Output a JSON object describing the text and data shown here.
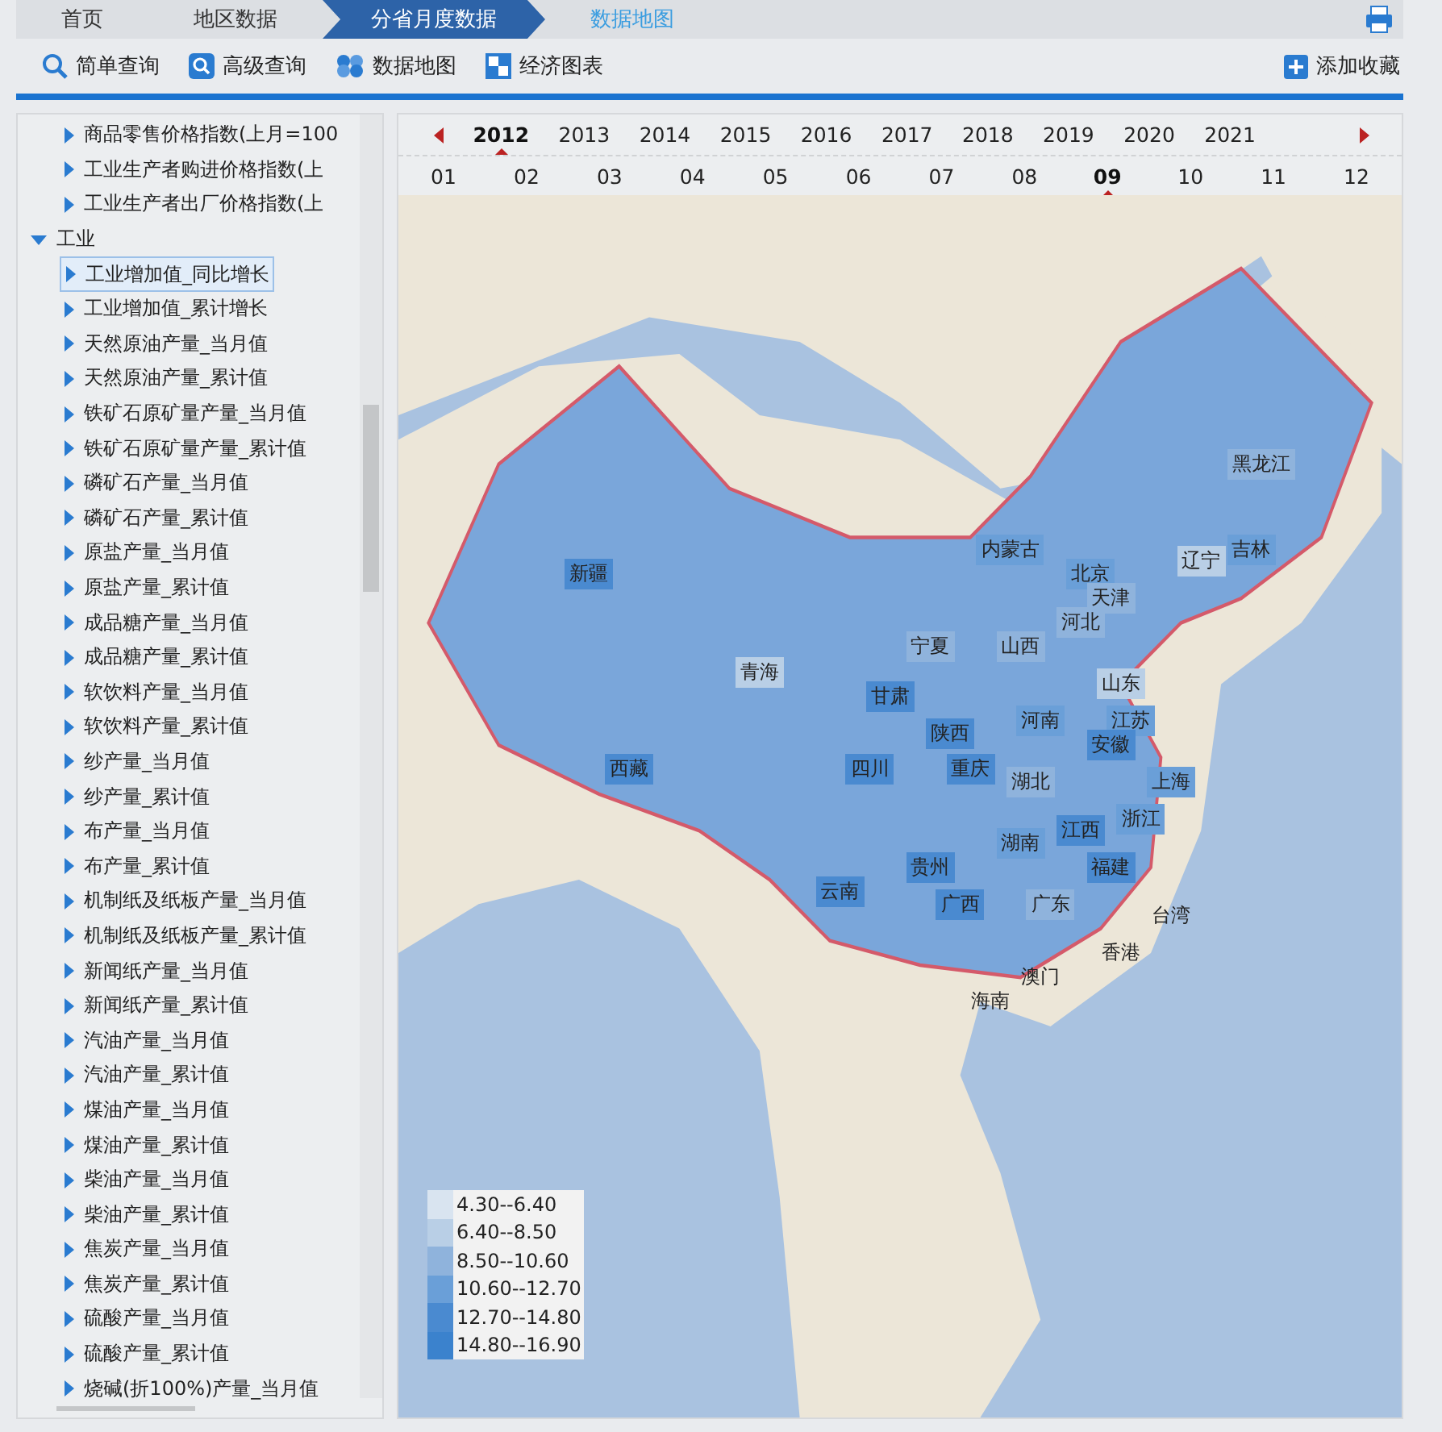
{
  "breadcrumb": [
    {
      "label": "首页",
      "selected": false
    },
    {
      "label": "地区数据",
      "selected": false
    },
    {
      "label": "分省月度数据",
      "selected": true
    },
    {
      "label": "数据地图",
      "selected": false
    }
  ],
  "toolbar": [
    {
      "label": "简单查询",
      "kind": "search"
    },
    {
      "label": "高级查询",
      "kind": "advanced"
    },
    {
      "label": "数据地图",
      "kind": "map"
    },
    {
      "label": "经济图表",
      "kind": "chart"
    }
  ],
  "add_favorite": "添加收藏",
  "tree": [
    {
      "children": [
        {
          "label": "商品零售价格指数(上月=100",
          "selected": false
        },
        {
          "label": "工业生产者购进价格指数(上",
          "selected": false
        },
        {
          "label": "工业生产者出厂价格指数(上",
          "selected": false
        }
      ]
    },
    {
      "label": "工业",
      "expanded": true,
      "children": [
        {
          "label": "工业增加值_同比增长",
          "selected": true
        },
        {
          "label": "工业增加值_累计增长",
          "selected": false
        },
        {
          "label": "天然原油产量_当月值",
          "selected": false
        },
        {
          "label": "天然原油产量_累计值",
          "selected": false
        },
        {
          "label": "铁矿石原矿量产量_当月值",
          "selected": false
        },
        {
          "label": "铁矿石原矿量产量_累计值",
          "selected": false
        },
        {
          "label": "磷矿石产量_当月值",
          "selected": false
        },
        {
          "label": "磷矿石产量_累计值",
          "selected": false
        },
        {
          "label": "原盐产量_当月值",
          "selected": false
        },
        {
          "label": "原盐产量_累计值",
          "selected": false
        },
        {
          "label": "成品糖产量_当月值",
          "selected": false
        },
        {
          "label": "成品糖产量_累计值",
          "selected": false
        },
        {
          "label": "软饮料产量_当月值",
          "selected": false
        },
        {
          "label": "软饮料产量_累计值",
          "selected": false
        },
        {
          "label": "纱产量_当月值",
          "selected": false
        },
        {
          "label": "纱产量_累计值",
          "selected": false
        },
        {
          "label": "布产量_当月值",
          "selected": false
        },
        {
          "label": "布产量_累计值",
          "selected": false
        },
        {
          "label": "机制纸及纸板产量_当月值",
          "selected": false
        },
        {
          "label": "机制纸及纸板产量_累计值",
          "selected": false
        },
        {
          "label": "新闻纸产量_当月值",
          "selected": false
        },
        {
          "label": "新闻纸产量_累计值",
          "selected": false
        },
        {
          "label": "汽油产量_当月值",
          "selected": false
        },
        {
          "label": "汽油产量_累计值",
          "selected": false
        },
        {
          "label": "煤油产量_当月值",
          "selected": false
        },
        {
          "label": "煤油产量_累计值",
          "selected": false
        },
        {
          "label": "柴油产量_当月值",
          "selected": false
        },
        {
          "label": "柴油产量_累计值",
          "selected": false
        },
        {
          "label": "焦炭产量_当月值",
          "selected": false
        },
        {
          "label": "焦炭产量_累计值",
          "selected": false
        },
        {
          "label": "硫酸产量_当月值",
          "selected": false
        },
        {
          "label": "硫酸产量_累计值",
          "selected": false
        },
        {
          "label": "烧碱(折100%)产量_当月值",
          "selected": false
        }
      ]
    }
  ],
  "years": [
    {
      "label": "2012",
      "selected": true
    },
    {
      "label": "2013",
      "selected": false
    },
    {
      "label": "2014",
      "selected": false
    },
    {
      "label": "2015",
      "selected": false
    },
    {
      "label": "2016",
      "selected": false
    },
    {
      "label": "2017",
      "selected": false
    },
    {
      "label": "2018",
      "selected": false
    },
    {
      "label": "2019",
      "selected": false
    },
    {
      "label": "2020",
      "selected": false
    },
    {
      "label": "2021",
      "selected": false
    }
  ],
  "months": [
    {
      "label": "01",
      "selected": false
    },
    {
      "label": "02",
      "selected": false
    },
    {
      "label": "03",
      "selected": false
    },
    {
      "label": "04",
      "selected": false
    },
    {
      "label": "05",
      "selected": false
    },
    {
      "label": "06",
      "selected": false
    },
    {
      "label": "07",
      "selected": false
    },
    {
      "label": "08",
      "selected": false
    },
    {
      "label": "09",
      "selected": true
    },
    {
      "label": "10",
      "selected": false
    },
    {
      "label": "11",
      "selected": false
    },
    {
      "label": "12",
      "selected": false
    }
  ],
  "provinces": [
    {
      "name": "黑龙江",
      "color": "#8fb3dc"
    },
    {
      "name": "吉林",
      "color": "#6a9fd8"
    },
    {
      "name": "辽宁",
      "color": "#b9cfe6"
    },
    {
      "name": "内蒙古",
      "color": "#6a9fd8"
    },
    {
      "name": "北京",
      "color": "#6a9fd8"
    },
    {
      "name": "天津",
      "color": "#8fb3dc"
    },
    {
      "name": "河北",
      "color": "#8fb3dc"
    },
    {
      "name": "新疆",
      "color": "#4a8ad0"
    },
    {
      "name": "宁夏",
      "color": "#8fb3dc"
    },
    {
      "name": "山西",
      "color": "#8fb3dc"
    },
    {
      "name": "山东",
      "color": "#b9cfe6"
    },
    {
      "name": "青海",
      "color": "#b9cfe6"
    },
    {
      "name": "甘肃",
      "color": "#4a8ad0"
    },
    {
      "name": "陕西",
      "color": "#4a8ad0"
    },
    {
      "name": "河南",
      "color": "#6a9fd8"
    },
    {
      "name": "江苏",
      "color": "#6a9fd8"
    },
    {
      "name": "安徽",
      "color": "#4a8ad0"
    },
    {
      "name": "西藏",
      "color": "#4a8ad0"
    },
    {
      "name": "四川",
      "color": "#4a8ad0"
    },
    {
      "name": "重庆",
      "color": "#4a8ad0"
    },
    {
      "name": "湖北",
      "color": "#8fb3dc"
    },
    {
      "name": "上海",
      "color": "#6a9fd8"
    },
    {
      "name": "浙江",
      "color": "#6a9fd8"
    },
    {
      "name": "湖南",
      "color": "#6a9fd8"
    },
    {
      "name": "江西",
      "color": "#4a8ad0"
    },
    {
      "name": "贵州",
      "color": "#4a8ad0"
    },
    {
      "name": "云南",
      "color": "#4a8ad0"
    },
    {
      "name": "福建",
      "color": "#4a8ad0"
    },
    {
      "name": "广西",
      "color": "#4a8ad0"
    },
    {
      "name": "广东",
      "color": "#8fb3dc"
    },
    {
      "name": "台湾"
    },
    {
      "name": "香港"
    },
    {
      "name": "澳门"
    },
    {
      "name": "海南"
    }
  ],
  "legend": [
    {
      "label": "4.30--6.40",
      "color": "#d9e4f0"
    },
    {
      "label": "6.40--8.50",
      "color": "#b9cfe6"
    },
    {
      "label": "8.50--10.60",
      "color": "#8fb3dc"
    },
    {
      "label": "10.60--12.70",
      "color": "#6a9fd8"
    },
    {
      "label": "12.70--14.80",
      "color": "#4a8ad0"
    },
    {
      "label": "14.80--16.90",
      "color": "#3b82cd"
    }
  ]
}
